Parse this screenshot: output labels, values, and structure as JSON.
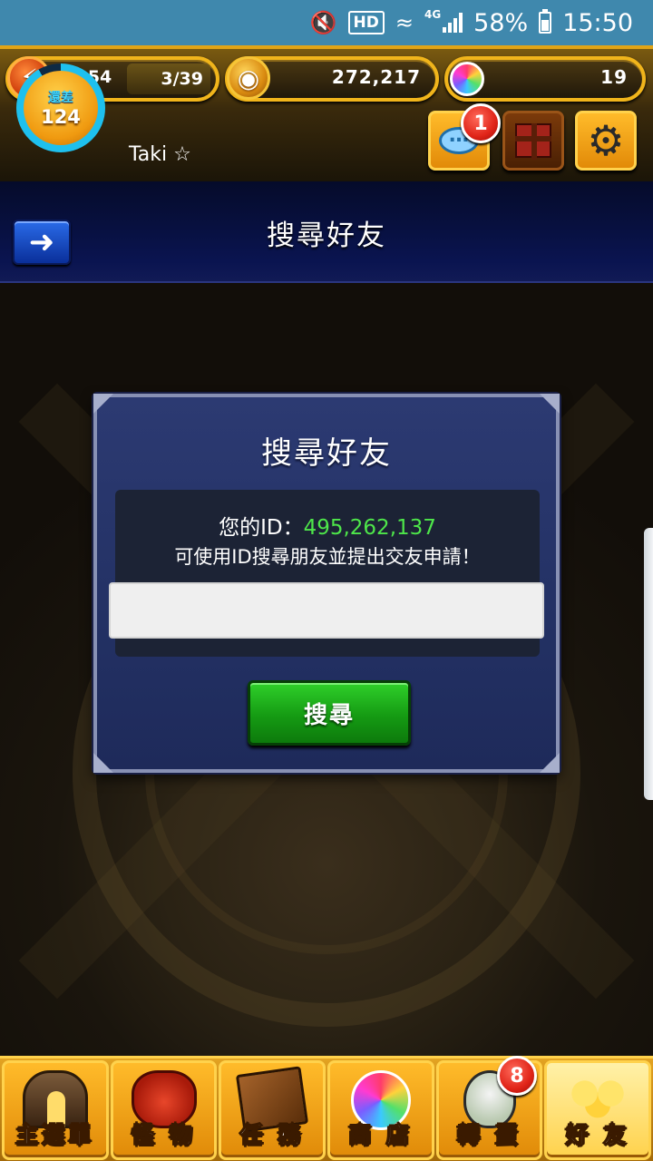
{
  "status_bar": {
    "network_type": "HD",
    "mobile_data": "4G",
    "battery": "58%",
    "time": "15:50",
    "icons": [
      "mute-icon",
      "wifi-icon",
      "signal-icon",
      "battery-icon"
    ]
  },
  "hud": {
    "energy": {
      "timer": "1:54",
      "stamina": "3/39",
      "icon": "lightning-icon"
    },
    "coins": {
      "value": "272,217",
      "icon": "coin-icon"
    },
    "orbs": {
      "value": "19",
      "icon": "orb-icon"
    },
    "rank": {
      "label": "還差",
      "value": "124"
    },
    "player_name": "Taki ☆",
    "chat_badge": "1"
  },
  "titlebar": {
    "title": "搜尋好友",
    "back_icon": "back-arrow-icon"
  },
  "dialog": {
    "title": "搜尋好友",
    "id_label": "您的ID：",
    "id_value": "495,262,137",
    "hint": "可使用ID搜尋朋友並提出交友申請！",
    "input_value": "",
    "search_label": "搜尋"
  },
  "bottom_nav": {
    "items": [
      {
        "label": "主選單",
        "icon": "main-menu-icon"
      },
      {
        "label": "怪 物",
        "icon": "monster-icon"
      },
      {
        "label": "任 務",
        "icon": "quest-icon"
      },
      {
        "label": "商 店",
        "icon": "shop-icon"
      },
      {
        "label": "轉 蛋",
        "icon": "gacha-icon"
      },
      {
        "label": "好 友",
        "icon": "friends-icon"
      }
    ],
    "egg_badge": "8",
    "active": "好 友"
  }
}
